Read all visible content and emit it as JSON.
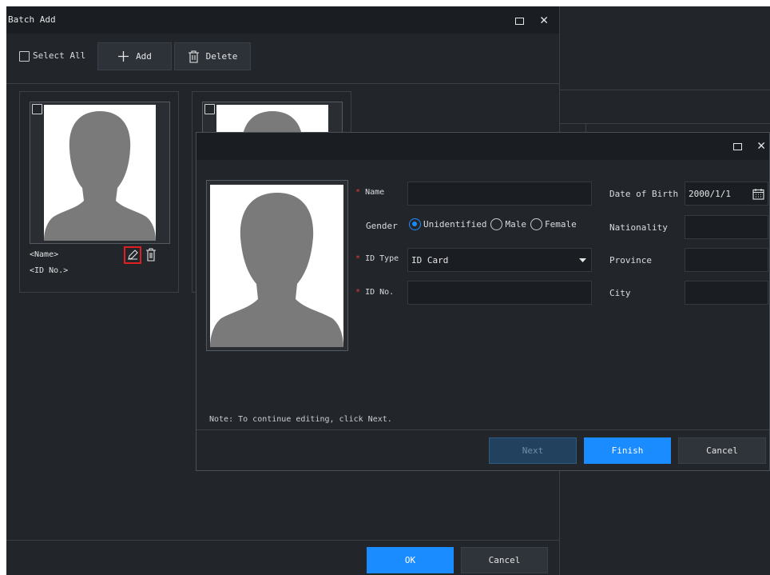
{
  "batch_add": {
    "title": "Batch Add",
    "toolbar": {
      "select_all_label": "Select All",
      "add_label": "Add",
      "delete_label": "Delete"
    },
    "cards": [
      {
        "name_placeholder": "<Name>",
        "id_placeholder": "<ID No.>"
      }
    ],
    "footer": {
      "ok_label": "OK",
      "cancel_label": "Cancel"
    }
  },
  "edit_dialog": {
    "form": {
      "name_label": "Name",
      "name_value": "",
      "gender_label": "Gender",
      "gender_options": [
        "Unidentified",
        "Male",
        "Female"
      ],
      "gender_selected": "Unidentified",
      "id_type_label": "ID Type",
      "id_type_value": "ID Card",
      "id_no_label": "ID No.",
      "id_no_value": "",
      "dob_label": "Date of Birth",
      "dob_value": "2000/1/1",
      "nationality_label": "Nationality",
      "nationality_value": "",
      "province_label": "Province",
      "province_value": "",
      "city_label": "City",
      "city_value": "",
      "required_mark": "*"
    },
    "note": "Note: To continue editing, click Next.",
    "buttons": {
      "next_label": "Next",
      "finish_label": "Finish",
      "cancel_label": "Cancel"
    }
  },
  "colors": {
    "window_bg": "#22262b",
    "titlebar_bg": "#1a1d21",
    "primary": "#1a8cff",
    "required": "#e03b3b",
    "highlight_box": "#e02020"
  }
}
